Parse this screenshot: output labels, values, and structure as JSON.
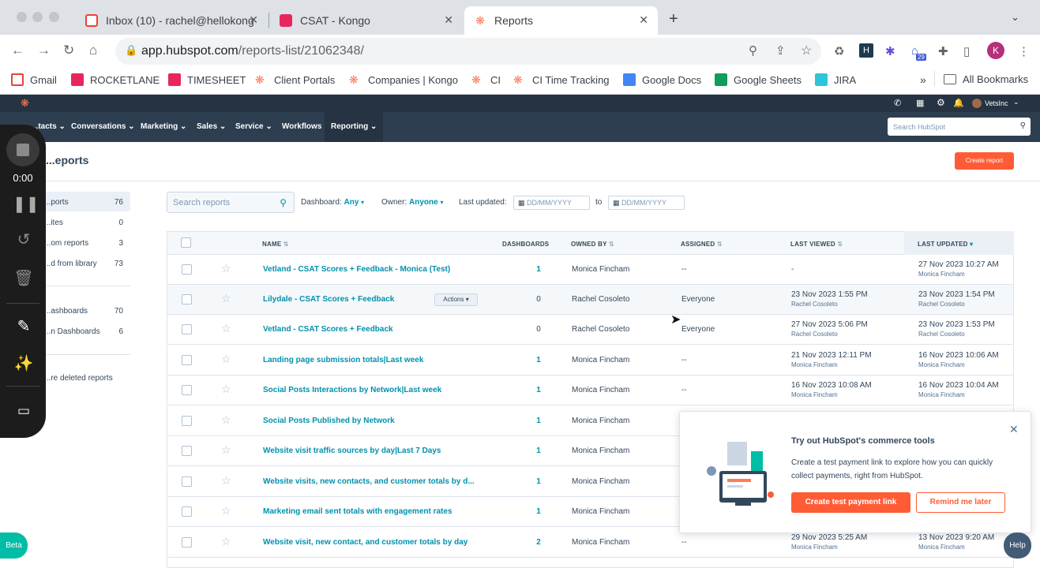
{
  "browser": {
    "tabs": [
      {
        "title": "Inbox (10) - rachel@hellokong",
        "icon": "gmail-icon"
      },
      {
        "title": "CSAT - Kongo",
        "icon": "kongo-icon"
      },
      {
        "title": "Reports",
        "icon": "hubspot-icon"
      }
    ],
    "new_tab": "+",
    "url_host": "app.hubspot.com",
    "url_path": "/reports-list/21062348/",
    "extension_badge": "29",
    "profile_initial": "K",
    "bookmarks": [
      {
        "label": "Gmail",
        "color": "#ea4335"
      },
      {
        "label": "ROCKETLANE",
        "color": "#e8265e"
      },
      {
        "label": "TIMESHEET",
        "color": "#e8265e"
      },
      {
        "label": "Client Portals",
        "color": "#ff7a59"
      },
      {
        "label": "Companies | Kongo",
        "color": "#ff7a59"
      },
      {
        "label": "CI",
        "color": "#ff7a59"
      },
      {
        "label": "CI Time Tracking",
        "color": "#ff7a59"
      },
      {
        "label": "Google Docs",
        "color": "#4285f4"
      },
      {
        "label": "Google Sheets",
        "color": "#0f9d58"
      },
      {
        "label": "JIRA",
        "color": "#2dc5d9"
      }
    ],
    "bookmarks_more": "»",
    "all_bookmarks": "All Bookmarks"
  },
  "hubspot": {
    "account": "VetsInc",
    "nav": [
      "...tacts",
      "Conversations",
      "Marketing",
      "Sales",
      "Service",
      "Workflows",
      "Reporting"
    ],
    "search_placeholder": "Search HubSpot",
    "page_title": "...eports",
    "create_report": "Create report",
    "sidebar": [
      {
        "label": "...ports",
        "count": "76"
      },
      {
        "label": "...ites",
        "count": "0"
      },
      {
        "label": "...om reports",
        "count": "3"
      },
      {
        "label": "...d from library",
        "count": "73"
      },
      {
        "label": "...ashboards",
        "count": "70"
      },
      {
        "label": "...n Dashboards",
        "count": "6"
      },
      {
        "label": "...re deleted reports",
        "count": ""
      }
    ],
    "filters": {
      "search_placeholder": "Search reports",
      "dashboard_label": "Dashboard:",
      "dashboard_value": "Any",
      "owner_label": "Owner:",
      "owner_value": "Anyone",
      "last_updated_label": "Last updated:",
      "date_from": "DD/MM/YYYY",
      "to": "to",
      "date_to": "DD/MM/YYYY"
    },
    "columns": [
      "NAME",
      "DASHBOARDS",
      "OWNED BY",
      "ASSIGNED",
      "LAST VIEWED",
      "LAST UPDATED"
    ],
    "actions_label": "Actions",
    "rows": [
      {
        "name": "Vetland - CSAT Scores + Feedback - Monica (Test)",
        "dashboards": "1",
        "owner": "Monica Fincham",
        "assigned": "--",
        "last_viewed": "-",
        "last_viewed_by": "",
        "last_updated": "27 Nov 2023 10:27 AM",
        "last_updated_by": "Monica Fincham"
      },
      {
        "name": "Lilydale - CSAT Scores + Feedback",
        "dashboards": "0",
        "owner": "Rachel Cosoleto",
        "assigned": "Everyone",
        "last_viewed": "23 Nov 2023 1:55 PM",
        "last_viewed_by": "Rachel Cosoleto",
        "last_updated": "23 Nov 2023 1:54 PM",
        "last_updated_by": "Rachel Cosoleto"
      },
      {
        "name": "Vetland - CSAT Scores + Feedback",
        "dashboards": "0",
        "owner": "Rachel Cosoleto",
        "assigned": "Everyone",
        "last_viewed": "27 Nov 2023 5:06 PM",
        "last_viewed_by": "Rachel Cosoleto",
        "last_updated": "23 Nov 2023 1:53 PM",
        "last_updated_by": "Rachel Cosoleto"
      },
      {
        "name": "Landing page submission totals|Last week",
        "dashboards": "1",
        "owner": "Monica Fincham",
        "assigned": "--",
        "last_viewed": "21 Nov 2023 12:11 PM",
        "last_viewed_by": "Monica Fincham",
        "last_updated": "16 Nov 2023 10:06 AM",
        "last_updated_by": "Monica Fincham"
      },
      {
        "name": "Social Posts Interactions by Network|Last week",
        "dashboards": "1",
        "owner": "Monica Fincham",
        "assigned": "--",
        "last_viewed": "16 Nov 2023 10:08 AM",
        "last_viewed_by": "Monica Fincham",
        "last_updated": "16 Nov 2023 10:04 AM",
        "last_updated_by": "Monica Fincham"
      },
      {
        "name": "Social Posts Published by Network",
        "dashboards": "1",
        "owner": "Monica Fincham",
        "assigned": "",
        "last_viewed": "",
        "last_viewed_by": "",
        "last_updated": "",
        "last_updated_by": ""
      },
      {
        "name": "Website visit traffic sources by day|Last 7 Days",
        "dashboards": "1",
        "owner": "Monica Fincham",
        "assigned": "",
        "last_viewed": "",
        "last_viewed_by": "",
        "last_updated": "",
        "last_updated_by": ""
      },
      {
        "name": "Website visits, new contacts, and customer totals by d...",
        "dashboards": "1",
        "owner": "Monica Fincham",
        "assigned": "",
        "last_viewed": "",
        "last_viewed_by": "",
        "last_updated": "",
        "last_updated_by": ""
      },
      {
        "name": "Marketing email sent totals with engagement rates",
        "dashboards": "1",
        "owner": "Monica Fincham",
        "assigned": "",
        "last_viewed": "",
        "last_viewed_by": "",
        "last_updated": "",
        "last_updated_by": ""
      },
      {
        "name": "Website visit, new contact, and customer totals by day",
        "dashboards": "2",
        "owner": "Monica Fincham",
        "assigned": "--",
        "last_viewed": "29 Nov 2023 5:25 AM",
        "last_viewed_by": "Monica Fincham",
        "last_updated": "13 Nov 2023 9:20 AM",
        "last_updated_by": "Monica Fincham"
      }
    ],
    "popup": {
      "title": "Try out HubSpot's commerce tools",
      "body": "Create a test payment link to explore how you can quickly collect payments, right from HubSpot.",
      "primary": "Create test payment link",
      "secondary": "Remind me later"
    },
    "beta": "Beta",
    "help": "Help"
  },
  "recorder": {
    "timer": "0:00"
  }
}
